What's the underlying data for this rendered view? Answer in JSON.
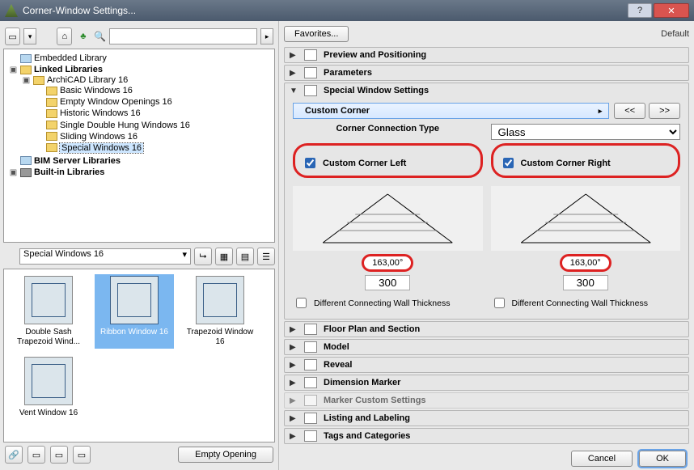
{
  "window": {
    "title": "Corner-Window Settings..."
  },
  "left_toolbar": {
    "search_placeholder": ""
  },
  "tree": {
    "embedded": "Embedded Library",
    "linked": "Linked Libraries",
    "archicad": "ArchiCAD Library 16",
    "basic": "Basic Windows 16",
    "empty": "Empty Window Openings 16",
    "historic": "Historic Windows 16",
    "single": "Single Double Hung Windows 16",
    "sliding": "Sliding Windows 16",
    "special": "Special Windows 16",
    "bim": "BIM Server Libraries",
    "builtin": "Built-in Libraries"
  },
  "folder_bar": {
    "current": "Special Windows 16"
  },
  "thumbs": [
    {
      "cap": "Double Sash Trapezoid Wind..."
    },
    {
      "cap": "Ribbon Window 16"
    },
    {
      "cap": "Trapezoid Window 16"
    },
    {
      "cap": "Vent Window 16"
    }
  ],
  "bottom_left": {
    "empty_opening": "Empty Opening"
  },
  "favorites_btn": "Favorites...",
  "default_label": "Default",
  "sections": {
    "preview": "Preview and Positioning",
    "params": "Parameters",
    "special": "Special Window Settings",
    "floor": "Floor Plan and Section",
    "model": "Model",
    "reveal": "Reveal",
    "dim": "Dimension Marker",
    "marker": "Marker Custom Settings",
    "listing": "Listing and Labeling",
    "tags": "Tags and Categories"
  },
  "special": {
    "subheader": "Custom Corner",
    "nav_prev": "<<",
    "nav_next": ">>",
    "header_left": "Corner Connection Type",
    "glass_value": "Glass",
    "chk_left": "Custom Corner Left",
    "chk_right": "Custom Corner Right",
    "angle_left": "163,00°",
    "angle_right": "163,00°",
    "width_left": "300",
    "width_right": "300",
    "thick_left": "Different Connecting Wall Thickness",
    "thick_right": "Different Connecting Wall Thickness"
  },
  "buttons": {
    "cancel": "Cancel",
    "ok": "OK"
  }
}
